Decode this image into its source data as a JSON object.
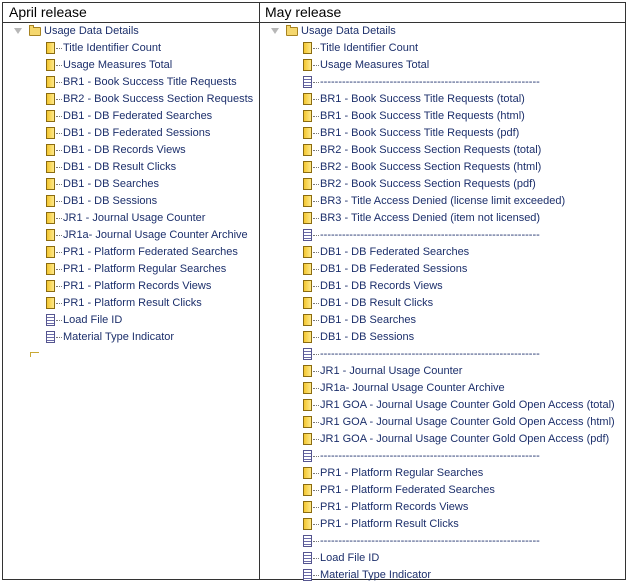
{
  "headers": {
    "left": "April release",
    "right": "May release"
  },
  "root_label": "Usage Data Details",
  "april_items": [
    {
      "label": "Title Identifier Count",
      "icon": "measure-icon"
    },
    {
      "label": "Usage Measures Total",
      "icon": "measure-icon"
    },
    {
      "label": "BR1 - Book Success Title Requests",
      "icon": "measure-icon"
    },
    {
      "label": "BR2 - Book Success Section Requests",
      "icon": "measure-icon"
    },
    {
      "label": "DB1 - DB Federated Searches",
      "icon": "measure-icon"
    },
    {
      "label": "DB1 - DB Federated Sessions",
      "icon": "measure-icon"
    },
    {
      "label": "DB1 - DB Records Views",
      "icon": "measure-icon"
    },
    {
      "label": "DB1 - DB Result Clicks",
      "icon": "measure-icon"
    },
    {
      "label": "DB1 - DB Searches",
      "icon": "measure-icon"
    },
    {
      "label": "DB1 - DB Sessions",
      "icon": "measure-icon"
    },
    {
      "label": "JR1 - Journal Usage Counter",
      "icon": "measure-icon"
    },
    {
      "label": "JR1a- Journal Usage Counter Archive",
      "icon": "measure-icon"
    },
    {
      "label": "PR1 - Platform Federated Searches",
      "icon": "measure-icon"
    },
    {
      "label": "PR1 - Platform Regular Searches",
      "icon": "measure-icon"
    },
    {
      "label": "PR1 - Platform Records Views",
      "icon": "measure-icon"
    },
    {
      "label": "PR1 - Platform Result Clicks",
      "icon": "measure-icon"
    },
    {
      "label": "Load File ID",
      "icon": "attribute-icon"
    },
    {
      "label": "Material Type Indicator",
      "icon": "attribute-icon"
    }
  ],
  "may_items": [
    {
      "label": "Title Identifier Count",
      "icon": "measure-icon"
    },
    {
      "label": "Usage Measures Total",
      "icon": "measure-icon"
    },
    {
      "label": "------------------------------------------------------------",
      "icon": "attribute-icon"
    },
    {
      "label": "BR1 - Book Success Title Requests (total)",
      "icon": "measure-icon"
    },
    {
      "label": "BR1 - Book Success Title Requests (html)",
      "icon": "measure-icon"
    },
    {
      "label": "BR1 - Book Success Title Requests (pdf)",
      "icon": "measure-icon"
    },
    {
      "label": "BR2 - Book Success Section Requests (total)",
      "icon": "measure-icon"
    },
    {
      "label": "BR2 - Book Success Section Requests (html)",
      "icon": "measure-icon"
    },
    {
      "label": "BR2 - Book Success Section Requests (pdf)",
      "icon": "measure-icon"
    },
    {
      "label": "BR3 - Title Access Denied (license limit exceeded)",
      "icon": "measure-icon"
    },
    {
      "label": "BR3 - Title Access Denied (item not licensed)",
      "icon": "measure-icon"
    },
    {
      "label": "------------------------------------------------------------",
      "icon": "attribute-icon"
    },
    {
      "label": "DB1 - DB Federated Searches",
      "icon": "measure-icon"
    },
    {
      "label": "DB1 - DB Federated Sessions",
      "icon": "measure-icon"
    },
    {
      "label": "DB1 - DB Records Views",
      "icon": "measure-icon"
    },
    {
      "label": "DB1 - DB Result Clicks",
      "icon": "measure-icon"
    },
    {
      "label": "DB1 - DB Searches",
      "icon": "measure-icon"
    },
    {
      "label": "DB1 - DB Sessions",
      "icon": "measure-icon"
    },
    {
      "label": "------------------------------------------------------------",
      "icon": "attribute-icon"
    },
    {
      "label": "JR1 - Journal Usage Counter",
      "icon": "measure-icon"
    },
    {
      "label": "JR1a- Journal Usage Counter Archive",
      "icon": "measure-icon"
    },
    {
      "label": "JR1 GOA - Journal Usage Counter Gold Open Access (total)",
      "icon": "measure-icon"
    },
    {
      "label": "JR1 GOA - Journal Usage Counter Gold Open Access (html)",
      "icon": "measure-icon"
    },
    {
      "label": "JR1 GOA - Journal Usage Counter Gold Open Access (pdf)",
      "icon": "measure-icon"
    },
    {
      "label": "------------------------------------------------------------",
      "icon": "attribute-icon"
    },
    {
      "label": "PR1 - Platform Regular Searches",
      "icon": "measure-icon"
    },
    {
      "label": "PR1 - Platform Federated Searches",
      "icon": "measure-icon"
    },
    {
      "label": "PR1 - Platform Records Views",
      "icon": "measure-icon"
    },
    {
      "label": "PR1 - Platform Result Clicks",
      "icon": "measure-icon"
    },
    {
      "label": "------------------------------------------------------------",
      "icon": "attribute-icon"
    },
    {
      "label": "Load File ID",
      "icon": "attribute-icon"
    },
    {
      "label": "Material Type Indicator",
      "icon": "attribute-icon"
    }
  ]
}
